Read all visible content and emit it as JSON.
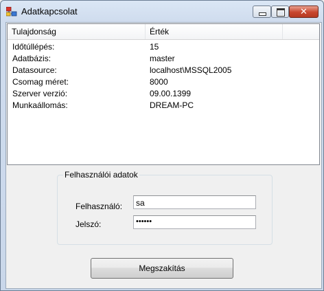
{
  "window": {
    "title": "Adatkapcsolat",
    "controls": {
      "minimize_icon": "minimize-icon",
      "maximize_icon": "maximize-icon",
      "close_symbol": "✕"
    }
  },
  "list": {
    "columns": [
      "Tulajdonság",
      "Érték",
      ""
    ],
    "rows": [
      {
        "property": "Időtúllépés:",
        "value": "15"
      },
      {
        "property": "Adatbázis:",
        "value": "master"
      },
      {
        "property": "Datasource:",
        "value": "localhost\\MSSQL2005"
      },
      {
        "property": "Csomag méret:",
        "value": "8000"
      },
      {
        "property": "Szerver verzió:",
        "value": "09.00.1399"
      },
      {
        "property": "Munkaállomás:",
        "value": "DREAM-PC"
      }
    ]
  },
  "user_group": {
    "title": "Felhasználói adatok",
    "username_label": "Felhasználó:",
    "username_value": "sa",
    "password_label": "Jelszó:",
    "password_value": "••••••"
  },
  "buttons": {
    "cancel": "Megszakítás"
  },
  "colors": {
    "title_bar": "#cfdcee",
    "close_button": "#c8462e",
    "client_bg": "#f0f0f0"
  }
}
